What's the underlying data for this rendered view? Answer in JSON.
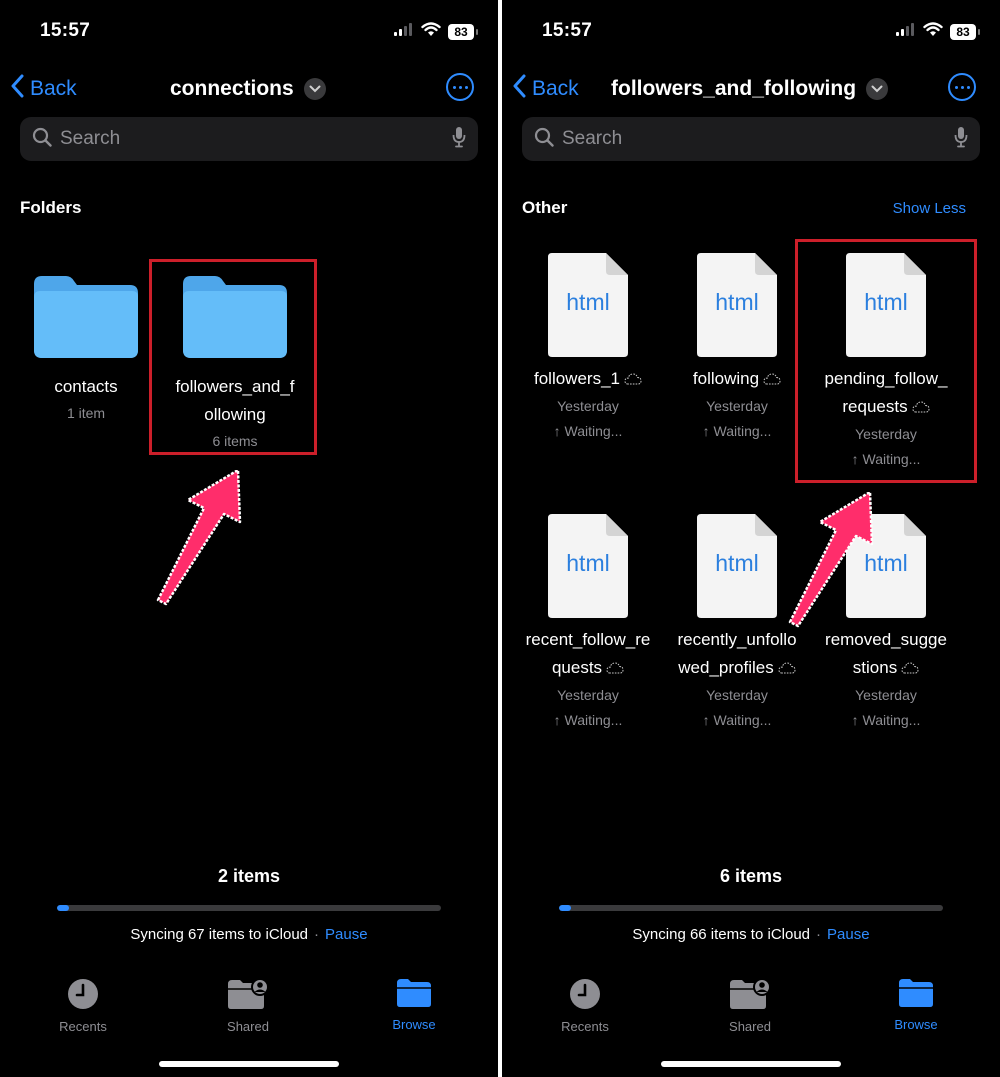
{
  "left": {
    "status": {
      "time": "15:57",
      "battery": "83"
    },
    "nav": {
      "back_label": "Back",
      "title": "connections"
    },
    "search": {
      "placeholder": "Search"
    },
    "section_title": "Folders",
    "items": [
      {
        "name": "contacts",
        "subtitle": "1 item",
        "icon": "folder-icon"
      },
      {
        "name_line1": "followers_and_f",
        "name_line2": "ollowing",
        "subtitle": "6 items",
        "icon": "folder-icon"
      }
    ],
    "footer": {
      "count": "2 items",
      "sync_text": "Syncing 67 items to iCloud",
      "separator": "·",
      "pause_label": "Pause",
      "progress": 0.03
    },
    "tabs": [
      {
        "label": "Recents",
        "icon": "clock-icon",
        "active": false
      },
      {
        "label": "Shared",
        "icon": "shared-folder-icon",
        "active": false
      },
      {
        "label": "Browse",
        "icon": "folder-icon",
        "active": true
      }
    ]
  },
  "right": {
    "status": {
      "time": "15:57",
      "battery": "83"
    },
    "nav": {
      "back_label": "Back",
      "title": "followers_and_following"
    },
    "search": {
      "placeholder": "Search"
    },
    "section_title": "Other",
    "show_less_label": "Show Less",
    "files": [
      {
        "line1": "followers_1",
        "line2": "",
        "date": "Yesterday",
        "status": "↑ Waiting...",
        "type": "html"
      },
      {
        "line1": "following",
        "line2": "",
        "date": "Yesterday",
        "status": "↑ Waiting...",
        "type": "html"
      },
      {
        "line1": "pending_follow_",
        "line2": "requests",
        "date": "Yesterday",
        "status": "↑ Waiting...",
        "type": "html"
      },
      {
        "line1": "recent_follow_re",
        "line2": "quests",
        "date": "Yesterday",
        "status": "↑ Waiting...",
        "type": "html"
      },
      {
        "line1": "recently_unfollo",
        "line2": "wed_profiles",
        "date": "Yesterday",
        "status": "↑ Waiting...",
        "type": "html"
      },
      {
        "line1": "removed_sugge",
        "line2": "stions",
        "date": "Yesterday",
        "status": "↑ Waiting...",
        "type": "html"
      }
    ],
    "footer": {
      "count": "6 items",
      "sync_text": "Syncing 66 items to iCloud",
      "separator": "·",
      "pause_label": "Pause",
      "progress": 0.03
    },
    "tabs": [
      {
        "label": "Recents",
        "icon": "clock-icon",
        "active": false
      },
      {
        "label": "Shared",
        "icon": "shared-folder-icon",
        "active": false
      },
      {
        "label": "Browse",
        "icon": "folder-icon",
        "active": true
      }
    ]
  },
  "colors": {
    "accent": "#2f8cff",
    "highlight": "#cc1f2a",
    "arrow": "#ff2d6b",
    "folder": "#5eb5f7"
  }
}
